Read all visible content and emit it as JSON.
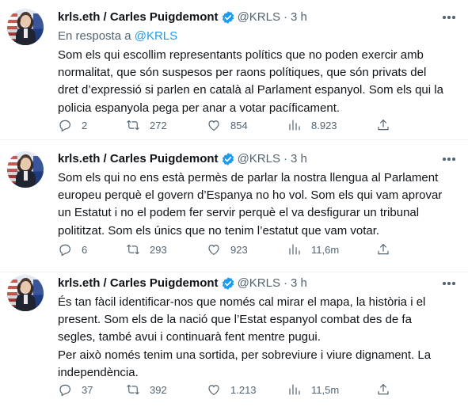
{
  "tweets": [
    {
      "name": "krls.eth / Carles Puigdemont",
      "handle": "@KRLS",
      "separator": "·",
      "time": "3 h",
      "reply_prefix": "En resposta a",
      "reply_handle": "@KRLS",
      "text": "Som els qui escollim representants polítics que no poden exercir amb\nnormalitat, que són suspesos per raons polítiques, que són privats del\ndret d’expressió si parlen en català al Parlament espanyol. Som els qui la\npolicia espanyola pega per anar a votar pacíficament.",
      "replies": "2",
      "retweets": "272",
      "likes": "854",
      "views": "8.923"
    },
    {
      "name": "krls.eth / Carles Puigdemont",
      "handle": "@KRLS",
      "separator": "·",
      "time": "3 h",
      "text": "Som els qui no ens està permès de parlar la nostra llengua al Parlament\neuropeu perquè el govern d’Espanya no ho vol. Som els qui vam aprovar\nun Estatut i no el podem fer servir perquè el va desfigurar un tribunal\npolititzat. Som els únics que no tenim l’estatut que vam votar.",
      "replies": "6",
      "retweets": "293",
      "likes": "923",
      "views": "11,6m"
    },
    {
      "name": "krls.eth / Carles Puigdemont",
      "handle": "@KRLS",
      "separator": "·",
      "time": "3 h",
      "text": "És tan fàcil identificar-nos que només cal mirar el mapa, la història i el\npresent. Som els de la nació que l’Estat espanyol combat des de fa\nsegles, també avui i continuarà fent mentre pugui.\nPer això només tenim una sortida, per sobreviure i viure dignament. La\nindependència.",
      "replies": "37",
      "retweets": "392",
      "likes": "1.213",
      "views": "11,5m"
    }
  ],
  "colors": {
    "text": "#0f1419",
    "secondary": "#536471",
    "accent": "#1d9bf0",
    "verified": "#1d9bf0",
    "divider": "#eff3f4",
    "thread_line": "#cfd9de"
  },
  "icons": {
    "more": "more-horizontal-icon",
    "verified": "verified-badge-icon",
    "reply": "reply-bubble-icon",
    "retweet": "retweet-icon",
    "like": "heart-icon",
    "views": "bar-chart-icon",
    "share": "share-upload-icon"
  }
}
